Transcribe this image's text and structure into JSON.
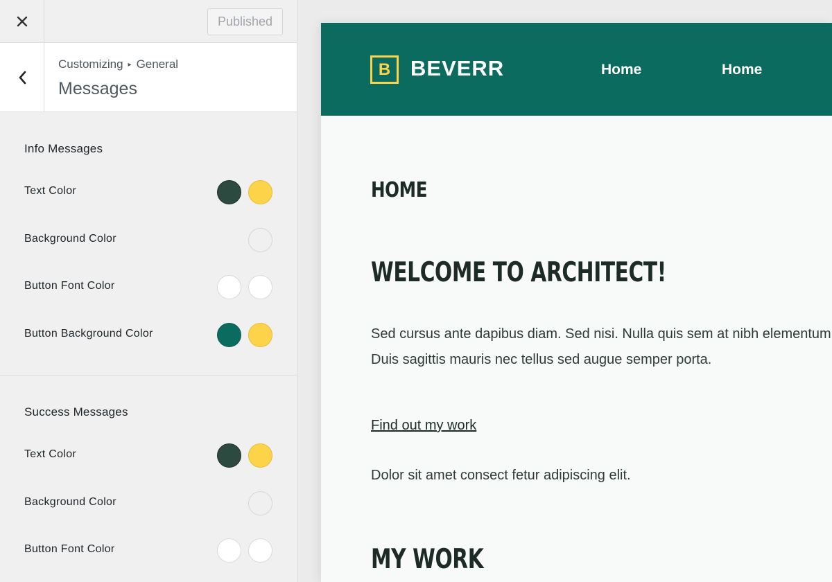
{
  "topbar": {
    "close_icon": "close-icon",
    "publish_label": "Published"
  },
  "section": {
    "breadcrumb_root": "Customizing",
    "breadcrumb_child": "General",
    "title": "Messages",
    "back_icon": "chevron-left-icon"
  },
  "groups": [
    {
      "title": "Info Messages",
      "rows": [
        {
          "label": "Text Color",
          "swatches": [
            "#2c4a40",
            "#fdd34a"
          ]
        },
        {
          "label": "Background Color",
          "swatches": [
            "#f0f0f0"
          ]
        },
        {
          "label": "Button Font Color",
          "swatches": [
            "#ffffff",
            "#ffffff"
          ]
        },
        {
          "label": "Button Background Color",
          "swatches": [
            "#0b6b5f",
            "#fdd34a"
          ]
        }
      ]
    },
    {
      "title": "Success Messages",
      "rows": [
        {
          "label": "Text Color",
          "swatches": [
            "#2c4a40",
            "#fdd34a"
          ]
        },
        {
          "label": "Background Color",
          "swatches": [
            "#f0f0f0"
          ]
        },
        {
          "label": "Button Font Color",
          "swatches": [
            "#ffffff",
            "#ffffff"
          ]
        }
      ]
    }
  ],
  "preview": {
    "logo_letter": "B",
    "brand": "BEVERR",
    "nav": [
      "Home",
      "Home"
    ],
    "page_heading": "HOME",
    "welcome_heading": "WELCOME TO ARCHITECT!",
    "paragraph_line1": "Sed cursus ante dapibus diam. Sed nisi. Nulla quis sem at nibh elementum",
    "paragraph_line2": "Duis sagittis mauris nec tellus sed augue semper porta.",
    "link_text": "Find out my work",
    "paragraph2": "Dolor sit amet consect fetur adipiscing elit.",
    "work_heading": "MY WORK",
    "colors": {
      "header": "#0b6b5f",
      "accent": "#fdd34a"
    }
  }
}
